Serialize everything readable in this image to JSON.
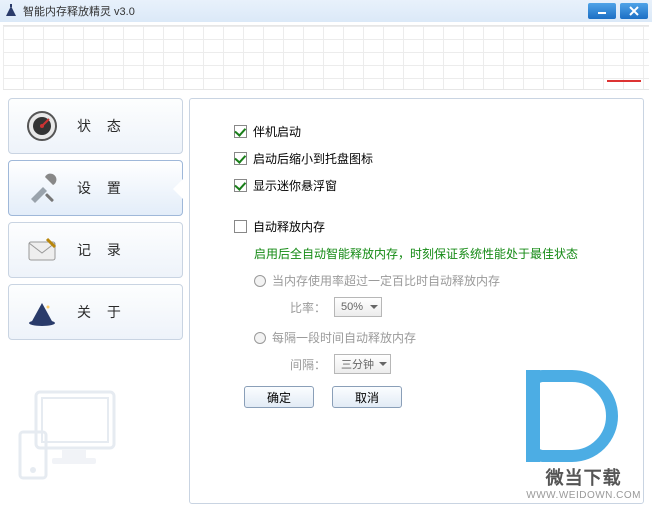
{
  "window": {
    "title": "智能内存释放精灵  v3.0"
  },
  "sidebar": {
    "items": [
      {
        "label": "状 态"
      },
      {
        "label": "设 置"
      },
      {
        "label": "记 录"
      },
      {
        "label": "关 于"
      }
    ]
  },
  "settings": {
    "startWithSystem": "伴机启动",
    "minimizeToTray": "启动后缩小到托盘图标",
    "showFloatWindow": "显示迷你悬浮窗",
    "autoRelease": "自动释放内存",
    "autoReleaseDesc": "启用后全自动智能释放内存，时刻保证系统性能处于最佳状态",
    "byUsage": "当内存使用率超过一定百比时自动释放内存",
    "ratioLabel": "比率：",
    "ratioValue": "50%",
    "byInterval": "每隔一段时间自动释放内存",
    "intervalLabel": "间隔：",
    "intervalValue": "三分钟",
    "ok": "确定",
    "cancel": "取消"
  },
  "watermark": {
    "text": "微当下载",
    "url": "WWW.WEIDOWN.COM"
  }
}
